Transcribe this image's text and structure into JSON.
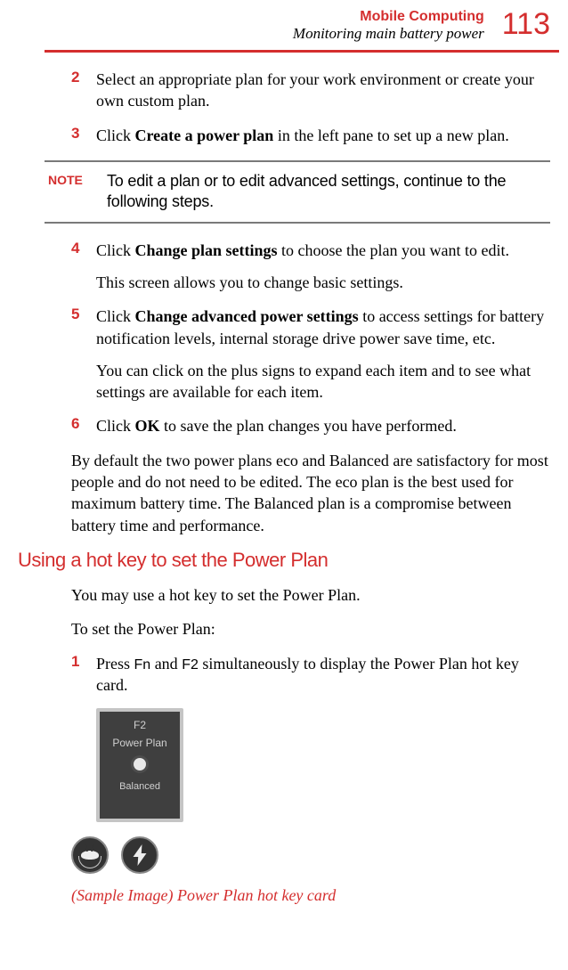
{
  "header": {
    "chapter": "Mobile Computing",
    "section": "Monitoring main battery power",
    "page": "113"
  },
  "steps_a": {
    "s2": {
      "num": "2",
      "text": "Select an appropriate plan for your work environment or create your own custom plan."
    },
    "s3": {
      "num": "3",
      "pre": "Click ",
      "bold": "Create a power plan",
      "post": " in the left pane to set up a new plan."
    }
  },
  "note": {
    "label": "NOTE",
    "text": "To edit a plan or to edit advanced settings, continue to the following steps."
  },
  "steps_b": {
    "s4": {
      "num": "4",
      "line1_pre": "Click ",
      "line1_bold": "Change plan settings",
      "line1_post": " to choose the plan you want to edit.",
      "line2": "This screen allows you to change basic settings."
    },
    "s5": {
      "num": "5",
      "line1_pre": "Click ",
      "line1_bold": "Change advanced power settings",
      "line1_post": " to access settings for battery notification levels, internal storage drive power save time, etc.",
      "line2": "You can click on the plus signs to expand each item and to see what settings are available for each item."
    },
    "s6": {
      "num": "6",
      "pre": "Click ",
      "bold": "OK",
      "post": " to save the plan changes you have performed."
    }
  },
  "body_para": "By default the two power plans eco and Balanced are satisfactory for most people and do not need to be edited. The eco plan is the best used for maximum battery time. The Balanced plan is a compromise between battery time and performance.",
  "heading2": "Using a hot key to set the Power Plan",
  "intro1": "You may use a hot key to set the Power Plan.",
  "intro2": "To set the Power Plan:",
  "steps_c": {
    "s1": {
      "num": "1",
      "pre": "Press ",
      "key1": "Fn",
      "mid": " and ",
      "key2": "F2",
      "post": " simultaneously to display the Power Plan hot key card."
    }
  },
  "card": {
    "key": "F2",
    "title": "Power Plan",
    "mode": "Balanced"
  },
  "caption": "(Sample Image) Power Plan hot key card"
}
